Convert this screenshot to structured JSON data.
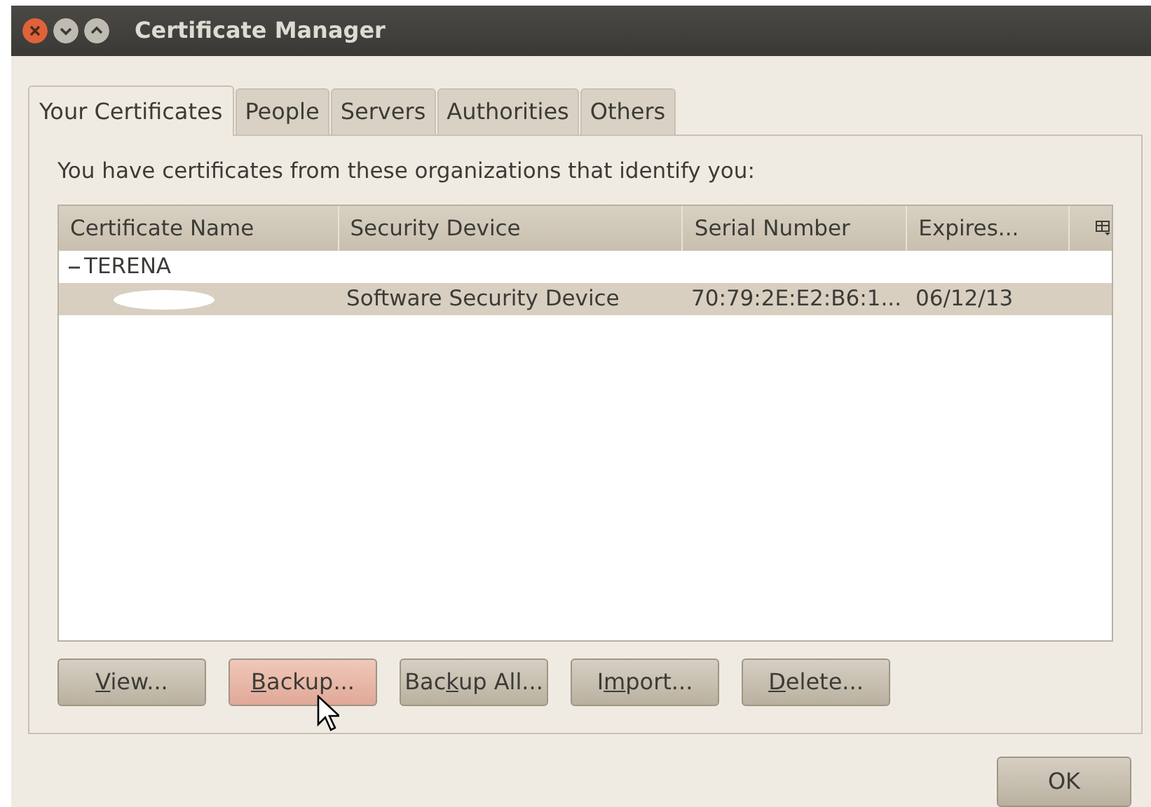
{
  "window": {
    "title": "Certificate Manager"
  },
  "tabs": [
    {
      "label": "Your Certificates",
      "selected": true
    },
    {
      "label": "People",
      "selected": false
    },
    {
      "label": "Servers",
      "selected": false
    },
    {
      "label": "Authorities",
      "selected": false
    },
    {
      "label": "Others",
      "selected": false
    }
  ],
  "intro": "You have certificates from these organizations that identify you:",
  "table": {
    "columns": [
      "Certificate Name",
      "Security Device",
      "Serial Number",
      "Expires..."
    ],
    "groups": [
      {
        "name": "TERENA",
        "expanded": true,
        "rows": [
          {
            "name_redacted": true,
            "device": "Software Security Device",
            "serial": "70:79:2E:E2:B6:1...",
            "expires": "06/12/13",
            "selected": true
          }
        ]
      }
    ]
  },
  "buttons": [
    {
      "key": "V",
      "after": "iew...",
      "hovered": false
    },
    {
      "key": "B",
      "after": "ackup...",
      "hovered": true
    },
    {
      "before": "Bac",
      "key": "k",
      "after": "up All...",
      "hovered": false
    },
    {
      "before": "I",
      "key": "m",
      "after": "port...",
      "hovered": false
    },
    {
      "key": "D",
      "after": "elete...",
      "hovered": false
    }
  ],
  "ok_button": "OK"
}
